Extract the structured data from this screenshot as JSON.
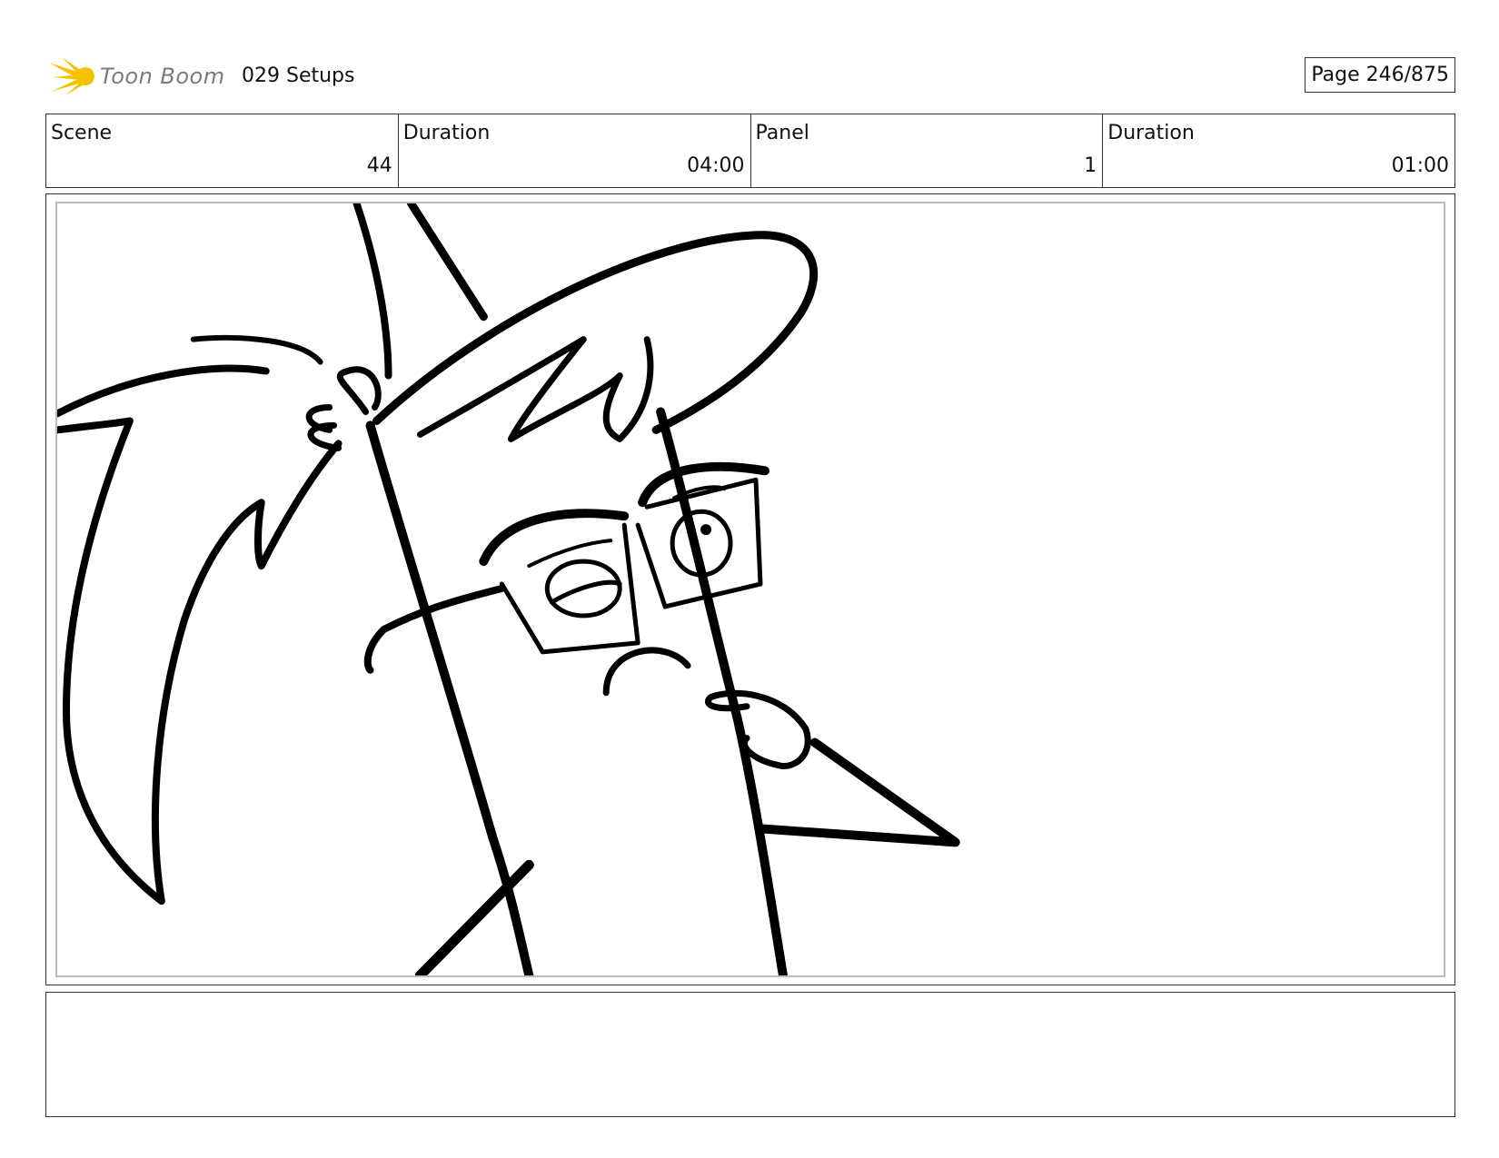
{
  "header": {
    "logo_text": "Toon Boom",
    "project_title": "029 Setups",
    "page_indicator": "Page 246/875"
  },
  "info": {
    "scene_label": "Scene",
    "scene_value": "44",
    "scene_duration_label": "Duration",
    "scene_duration_value": "04:00",
    "panel_label": "Panel",
    "panel_value": "1",
    "panel_duration_label": "Duration",
    "panel_duration_value": "01:00"
  },
  "colors": {
    "logo_star": "#f5c400",
    "logo_text": "#7a7a7a",
    "border": "#333333",
    "ink": "#000000"
  }
}
